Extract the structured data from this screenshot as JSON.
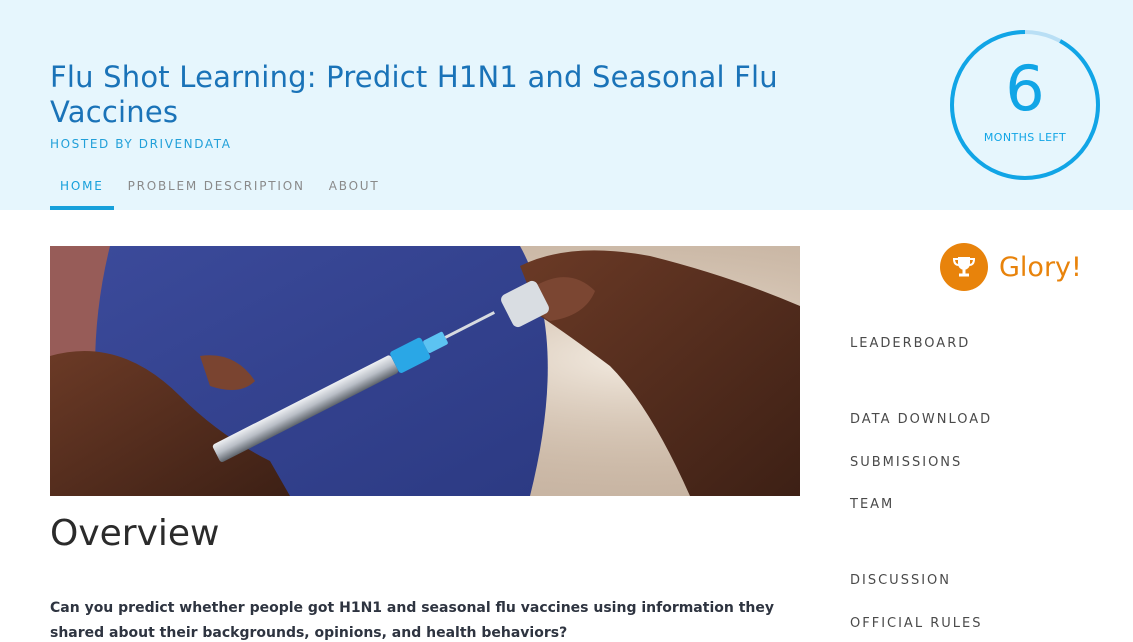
{
  "header": {
    "title": "Flu Shot Learning: Predict H1N1 and Seasonal Flu Vaccines",
    "hosted_by": "HOSTED BY DRIVENDATA",
    "tabs": [
      {
        "label": "HOME",
        "active": true
      },
      {
        "label": "PROBLEM DESCRIPTION",
        "active": false
      },
      {
        "label": "ABOUT",
        "active": false
      }
    ],
    "countdown": {
      "value": "6",
      "label": "MONTHS LEFT",
      "remaining_fraction": 0.92
    }
  },
  "hero_image": {
    "icon": "vaccine-syringe-photo"
  },
  "overview": {
    "title": "Overview",
    "text": "Can you predict whether people got H1N1 and seasonal flu vaccines using information they shared about their backgrounds, opinions, and health behaviors?"
  },
  "sidebar": {
    "prize": {
      "label": "Glory!",
      "icon": "trophy-icon"
    },
    "links": [
      {
        "label": "LEADERBOARD"
      },
      {
        "label": "DATA DOWNLOAD"
      },
      {
        "label": "SUBMISSIONS"
      },
      {
        "label": "TEAM"
      },
      {
        "label": "DISCUSSION"
      },
      {
        "label": "OFFICIAL RULES"
      }
    ]
  },
  "colors": {
    "header_bg": "#e6f6fd",
    "title": "#1a73b8",
    "accent": "#17a0db",
    "prize": "#e8830b",
    "ring_track": "#b9dff5"
  }
}
